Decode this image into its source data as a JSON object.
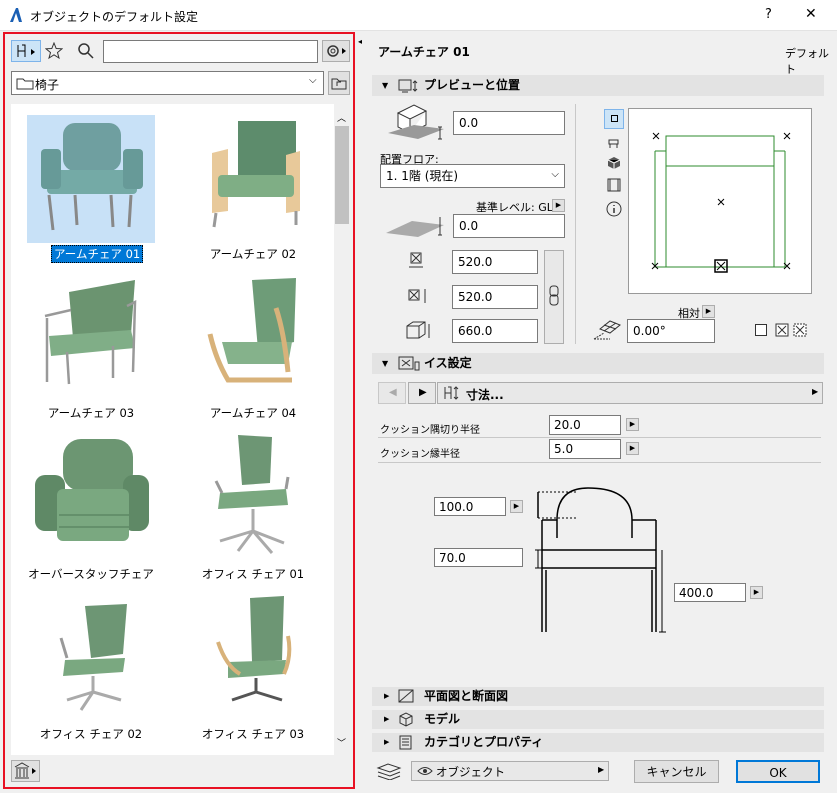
{
  "window": {
    "title": "オブジェクトのデフォルト設定",
    "help": "?",
    "close": "✕"
  },
  "left": {
    "search_placeholder": "",
    "folder": "椅子",
    "items": [
      {
        "label": "アームチェア 01",
        "selected": true
      },
      {
        "label": "アームチェア 02"
      },
      {
        "label": "アームチェア 03"
      },
      {
        "label": "アームチェア 04"
      },
      {
        "label": "オーバースタッフチェア"
      },
      {
        "label": "オフィス チェア 01"
      },
      {
        "label": "オフィス チェア 02"
      },
      {
        "label": "オフィス チェア 03"
      }
    ]
  },
  "right": {
    "object_name": "アームチェア 01",
    "default_label": "デフォルト",
    "preview_section": "プレビューと位置",
    "elevation": "0.0",
    "floor_label": "配置フロア:",
    "floor_value": "1. 1階 (現在)",
    "ref_level_label": "基準レベル: GL",
    "ref_value": "0.0",
    "dim_a": "520.0",
    "dim_b": "520.0",
    "dim_height": "660.0",
    "relative_label": "相対",
    "angle": "0.00°",
    "chair_section": "イス設定",
    "nav_label": "寸法...",
    "cushion_corner_label": "クッション隅切り半径",
    "cushion_corner_value": "20.0",
    "cushion_edge_label": "クッション縁半径",
    "cushion_edge_value": "5.0",
    "diagram_back": "100.0",
    "diagram_seat": "70.0",
    "diagram_height": "400.0",
    "sec_plan": "平面図と断面図",
    "sec_model": "モデル",
    "sec_category": "カテゴリとプロパティ"
  },
  "footer": {
    "layer": "オブジェクト",
    "cancel": "キャンセル",
    "ok": "OK"
  },
  "colors": {
    "accent": "#0078d7",
    "highlight_border": "#e81123",
    "plan_line": "#2e8b2e"
  }
}
